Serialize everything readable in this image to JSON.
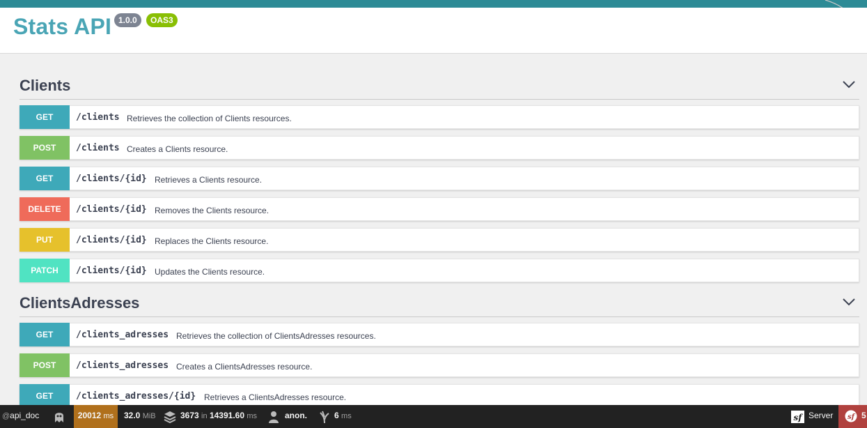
{
  "header": {
    "title": "Stats API",
    "version": "1.0.0",
    "oas": "OAS3"
  },
  "colors": {
    "get": "#3ea9b9",
    "post": "#80c264",
    "delete": "#ef6b5a",
    "put": "#e6c12c",
    "patch": "#50e3c2"
  },
  "sections": [
    {
      "title": "Clients",
      "toggle_icon": "chevron-down-icon",
      "operations": [
        {
          "method": "GET",
          "path": "/clients",
          "description": "Retrieves the collection of Clients resources."
        },
        {
          "method": "POST",
          "path": "/clients",
          "description": "Creates a Clients resource."
        },
        {
          "method": "GET",
          "path": "/clients/{id}",
          "description": "Retrieves a Clients resource."
        },
        {
          "method": "DELETE",
          "path": "/clients/{id}",
          "description": "Removes the Clients resource."
        },
        {
          "method": "PUT",
          "path": "/clients/{id}",
          "description": "Replaces the Clients resource."
        },
        {
          "method": "PATCH",
          "path": "/clients/{id}",
          "description": "Updates the Clients resource."
        }
      ]
    },
    {
      "title": "ClientsAdresses",
      "toggle_icon": "chevron-down-icon",
      "operations": [
        {
          "method": "GET",
          "path": "/clients_adresses",
          "description": "Retrieves the collection of ClientsAdresses resources."
        },
        {
          "method": "POST",
          "path": "/clients_adresses",
          "description": "Creates a ClientsAdresses resource."
        },
        {
          "method": "GET",
          "path": "/clients_adresses/{id}",
          "description": "Retrieves a ClientsAdresses resource."
        }
      ]
    }
  ],
  "debug_toolbar": {
    "route_prefix": "@",
    "route": "api_doc",
    "response_time": "20012",
    "response_time_unit": "ms",
    "memory": "32.0",
    "memory_unit": "MiB",
    "cache_calls": "3673",
    "cache_in": "in",
    "cache_time": "14391.60",
    "cache_unit": "ms",
    "user": "anon.",
    "twig_time": "6",
    "twig_unit": "ms",
    "server_label": "Server",
    "error_count": "5",
    "accent_time": "#b0701c",
    "accent_error": "#b0413e"
  }
}
